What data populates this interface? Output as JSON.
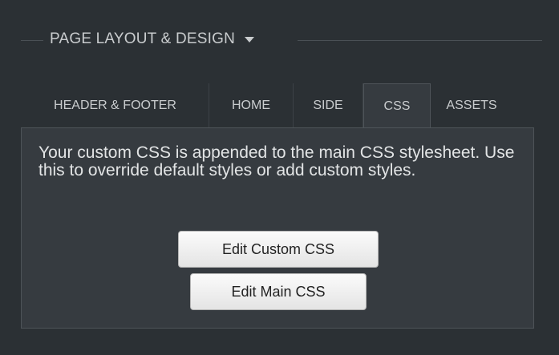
{
  "section": {
    "title": "PAGE LAYOUT & DESIGN"
  },
  "tabs": [
    {
      "label": "HEADER & FOOTER",
      "active": false
    },
    {
      "label": "HOME",
      "active": false
    },
    {
      "label": "SIDE",
      "active": false
    },
    {
      "label": "CSS",
      "active": true
    },
    {
      "label": "ASSETS",
      "active": false
    }
  ],
  "content": {
    "description": "Your custom CSS is appended to the main CSS stylesheet. Use this to override default styles or add custom styles.",
    "edit_custom_label": "Edit Custom CSS",
    "edit_main_label": "Edit Main CSS"
  },
  "colors": {
    "background": "#2b3034",
    "panel": "#363b40",
    "text": "#c9ccce",
    "button": "#f0f0f0"
  },
  "icons": {
    "dropdown": "caret-down-icon"
  }
}
